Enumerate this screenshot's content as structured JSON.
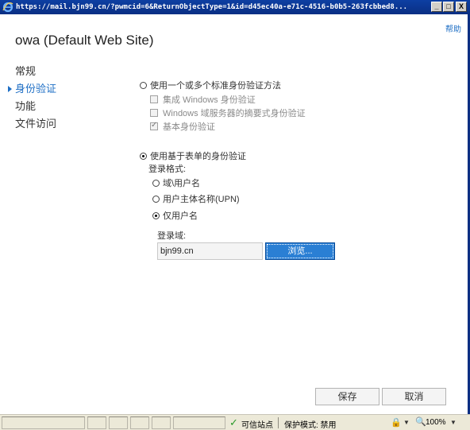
{
  "window": {
    "url": "https://mail.bjn99.cn/?pwmcid=6&ReturnObjectType=1&id=d45ec40a-e71c-4516-b0b5-263fcbbed8...",
    "minimize": "_",
    "maximize": "□",
    "close": "X"
  },
  "help": "帮助",
  "page_title": "owa (Default Web Site)",
  "nav": {
    "items": [
      {
        "label": "常规",
        "active": false
      },
      {
        "label": "身份验证",
        "active": true
      },
      {
        "label": "功能",
        "active": false
      },
      {
        "label": "文件访问",
        "active": false
      }
    ]
  },
  "auth": {
    "standard_option": "使用一个或多个标准身份验证方法",
    "integrated_windows": "集成 Windows 身份验证",
    "digest_auth": "Windows 域服务器的摘要式身份验证",
    "basic_auth": "基本身份验证",
    "forms_option": "使用基于表单的身份验证",
    "logon_format_label": "登录格式:",
    "format_domain_user": "域\\用户名",
    "format_upn": "用户主体名称(UPN)",
    "format_user_only": "仅用户名",
    "logon_domain_label": "登录域:",
    "logon_domain_value": "bjn99.cn",
    "browse": "浏览..."
  },
  "footer": {
    "save": "保存",
    "cancel": "取消"
  },
  "statusbar": {
    "trusted_site": "可信站点",
    "protected_mode": "保护模式: 禁用",
    "zoom": "100%"
  }
}
